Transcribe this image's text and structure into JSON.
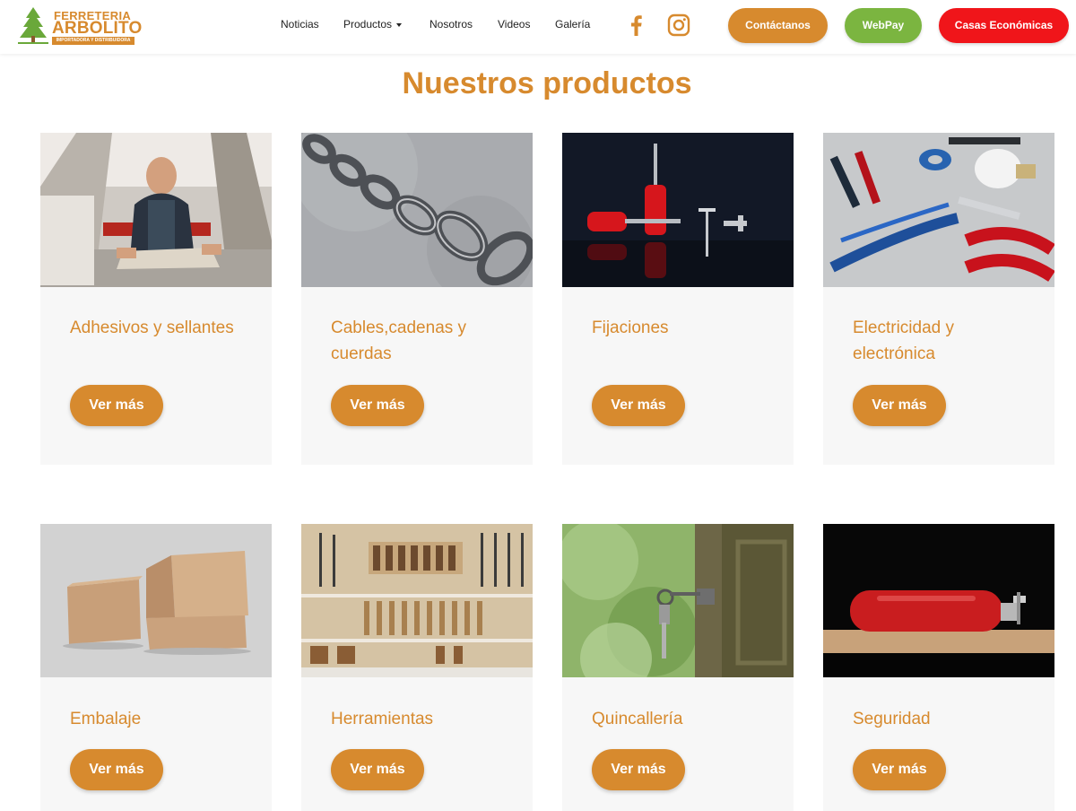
{
  "logo": {
    "line1": "FERRETERIA",
    "line2": "ARBOLITO",
    "line3": "IMPORTADORA Y DISTRIBUIDORA"
  },
  "nav": {
    "items": [
      {
        "label": "Noticias"
      },
      {
        "label": "Productos",
        "dropdown": true
      },
      {
        "label": "Nosotros"
      },
      {
        "label": "Videos"
      },
      {
        "label": "Galería"
      }
    ]
  },
  "social": {
    "facebook_icon": "facebook-icon",
    "instagram_icon": "instagram-icon"
  },
  "header_buttons": {
    "contact": "Contáctanos",
    "webpay": "WebPay",
    "casas": "Casas Económicas"
  },
  "colors": {
    "brand_orange": "#d78a2e",
    "webpay_green": "#7bb540",
    "casas_red": "#f0151a"
  },
  "section": {
    "title": "Nuestros productos"
  },
  "products": [
    {
      "title": "Adhesivos y sellantes",
      "button": "Ver más",
      "image": "worker-laying-tile"
    },
    {
      "title": "Cables,cadenas y cuerdas",
      "button": "Ver más",
      "image": "steel-chain"
    },
    {
      "title": "Fijaciones",
      "button": "Ver más",
      "image": "red-screwdrivers-and-screws"
    },
    {
      "title": "Electricidad y electrónica",
      "button": "Ver más",
      "image": "electrical-tools"
    },
    {
      "title": "Embalaje",
      "button": "Ver más",
      "image": "cardboard-boxes"
    },
    {
      "title": "Herramientas",
      "button": "Ver más",
      "image": "tool-wall"
    },
    {
      "title": "Quincallería",
      "button": "Ver más",
      "image": "key-in-door-lock"
    },
    {
      "title": "Seguridad",
      "button": "Ver más",
      "image": "red-fire-extinguisher"
    }
  ]
}
